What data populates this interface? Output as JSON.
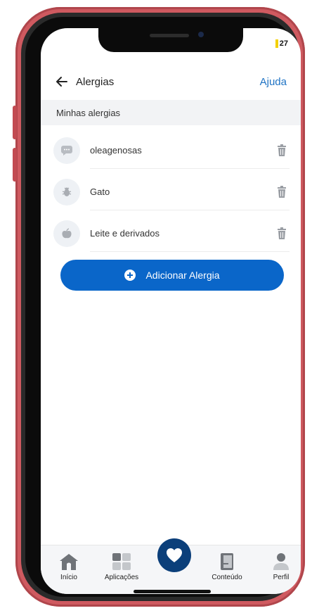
{
  "status": {
    "battery_text": "27",
    "battery_color": "#f3d000"
  },
  "header": {
    "title": "Alergias",
    "help_label": "Ajuda"
  },
  "section": {
    "title": "Minhas alergias"
  },
  "allergies": [
    {
      "label": "oleagenosas",
      "icon": "chat-bubble-icon"
    },
    {
      "label": "Gato",
      "icon": "bug-icon"
    },
    {
      "label": "Leite e derivados",
      "icon": "apple-icon"
    }
  ],
  "add_button": {
    "label": "Adicionar Alergia",
    "color": "#0a66c9"
  },
  "tabbar": {
    "tabs": [
      {
        "label": "Início",
        "icon": "home-icon"
      },
      {
        "label": "Aplicações",
        "icon": "grid-icon"
      },
      {
        "label": "",
        "icon": "heart-icon"
      },
      {
        "label": "Conteúdo",
        "icon": "book-icon"
      },
      {
        "label": "Perfil",
        "icon": "user-icon"
      }
    ]
  },
  "colors": {
    "phone_frame": "#cf5a60",
    "accent": "#1f73c4",
    "heart_button": "#0b3f7a"
  }
}
